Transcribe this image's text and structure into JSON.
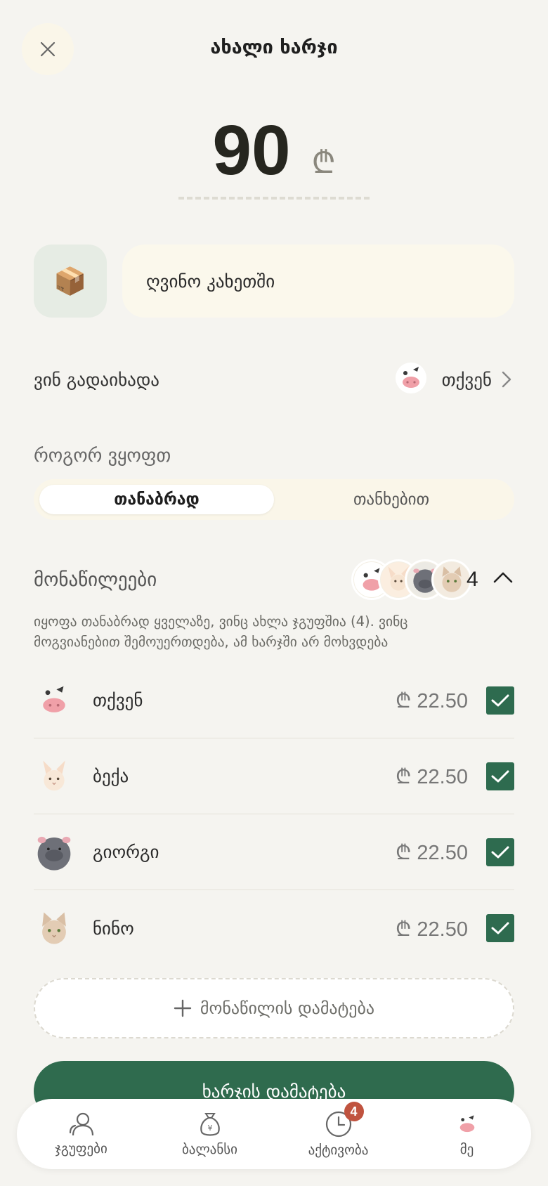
{
  "header": {
    "title": "ახალი ხარჯი"
  },
  "amount": {
    "value": "90",
    "currency": "₾"
  },
  "category": {
    "icon": "package-icon",
    "emoji": "📦"
  },
  "description": {
    "value": "ღვინო კახეთში"
  },
  "payer": {
    "label": "ვინ გადაიხადა",
    "name": "თქვენ"
  },
  "split": {
    "label": "როგორ ვყოფთ",
    "options": [
      "თანაბრად",
      "თანხებით"
    ],
    "selected": "თანაბრად"
  },
  "participants": {
    "label": "მონაწილეები",
    "count": "4",
    "note": "იყოფა თანაბრად ყველაზე, ვინც ახლა ჯგუფშია (4). ვინც მოგვიანებით შემოუერთდება, ამ ხარჯში არ მოხვდება",
    "rows": [
      {
        "name": "თქვენ",
        "amount": "₾ 22.50",
        "checked": true,
        "avatar": "cow-avatar"
      },
      {
        "name": "ბექა",
        "amount": "₾ 22.50",
        "checked": true,
        "avatar": "rabbit-avatar"
      },
      {
        "name": "გიორგი",
        "amount": "₾ 22.50",
        "checked": true,
        "avatar": "hippo-avatar"
      },
      {
        "name": "ნინო",
        "amount": "₾ 22.50",
        "checked": true,
        "avatar": "cat-avatar"
      }
    ],
    "add_label": "მონაწილის დამატება"
  },
  "primary_button": {
    "label": "ხარჯის დამატება"
  },
  "nav": {
    "items": [
      {
        "label": "ჯგუფები",
        "icon": "users-icon"
      },
      {
        "label": "ბალანსი",
        "icon": "money-bag-icon"
      },
      {
        "label": "აქტივობა",
        "icon": "clock-icon",
        "badge": "4"
      },
      {
        "label": "მე",
        "icon": "cow-avatar"
      }
    ]
  },
  "colors": {
    "accent": "#2f6b4e",
    "badge": "#c0533f",
    "background": "#f5f4f0"
  }
}
